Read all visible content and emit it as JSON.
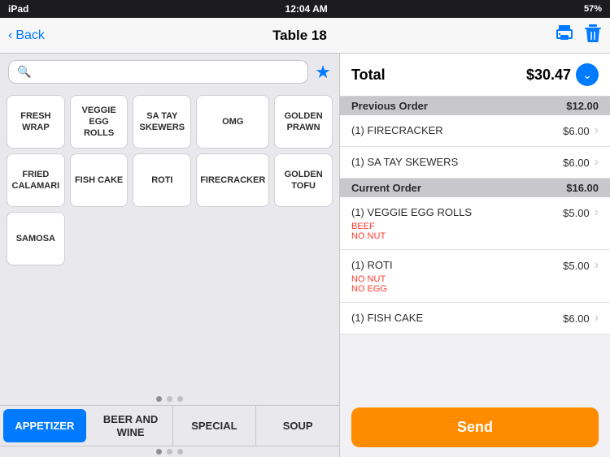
{
  "status_bar": {
    "left": "iPad",
    "time": "12:04 AM",
    "battery": "57%"
  },
  "nav": {
    "back_label": "Back",
    "title": "Table 18"
  },
  "search": {
    "placeholder": ""
  },
  "menu_items": [
    {
      "label": "FRESH WRAP"
    },
    {
      "label": "VEGGIE EGG ROLLS"
    },
    {
      "label": "SA TAY SKEWERS"
    },
    {
      "label": "OMG"
    },
    {
      "label": "GOLDEN PRAWN"
    },
    {
      "label": "FRIED CALAMARI"
    },
    {
      "label": "FISH CAKE"
    },
    {
      "label": "ROTI"
    },
    {
      "label": "FIRECRACKER"
    },
    {
      "label": "GOLDEN TOFU"
    },
    {
      "label": "SAMOSA"
    }
  ],
  "category_tabs": [
    {
      "label": "APPETIZER",
      "active": true
    },
    {
      "label": "BEER AND WINE",
      "active": false
    },
    {
      "label": "SPECIAL",
      "active": false
    },
    {
      "label": "SOUP",
      "active": false
    }
  ],
  "order": {
    "total_label": "Total",
    "total_amount": "$30.47",
    "sections": [
      {
        "name": "Previous Order",
        "amount": "$12.00",
        "items": [
          {
            "qty": "(1)",
            "name": "FIRECRACKER",
            "price": "$6.00",
            "mods": []
          },
          {
            "qty": "(1)",
            "name": "SA TAY SKEWERS",
            "price": "$6.00",
            "mods": []
          }
        ]
      },
      {
        "name": "Current Order",
        "amount": "$16.00",
        "items": [
          {
            "qty": "(1)",
            "name": "VEGGIE EGG ROLLS",
            "price": "$5.00",
            "mods": [
              "BEEF",
              "NO NUT"
            ]
          },
          {
            "qty": "(1)",
            "name": "ROTI",
            "price": "$5.00",
            "mods": [
              "NO NUT",
              "NO EGG"
            ]
          },
          {
            "qty": "(1)",
            "name": "FISH CAKE",
            "price": "$6.00",
            "mods": []
          }
        ]
      }
    ],
    "send_label": "Send"
  }
}
